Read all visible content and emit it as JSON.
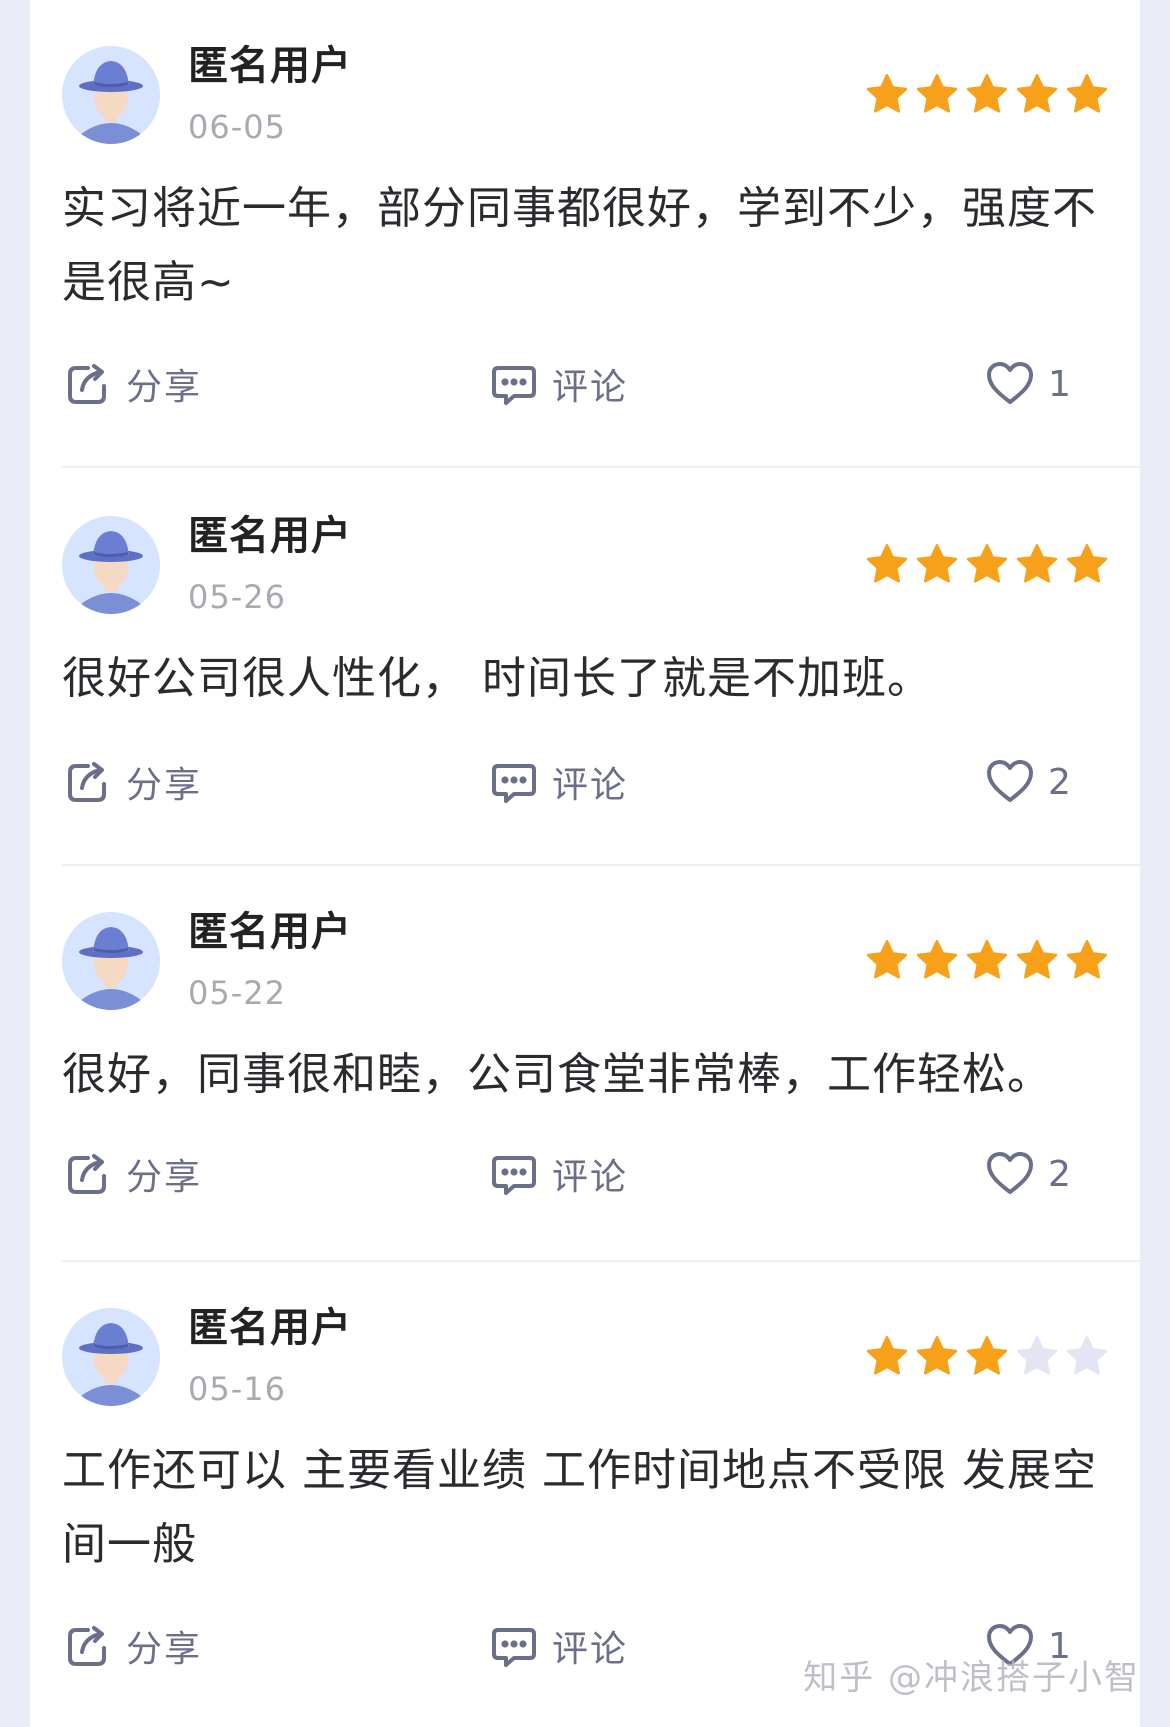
{
  "reviews": [
    {
      "username": "匿名用户",
      "date": "06-05",
      "rating": 5,
      "content": "实习将近一年，部分同事都很好，学到不少，强度不是很高~",
      "share_label": "分享",
      "comment_label": "评论",
      "likes": "1"
    },
    {
      "username": "匿名用户",
      "date": "05-26",
      "rating": 5,
      "content": "很好公司很人性化， 时间长了就是不加班。",
      "share_label": "分享",
      "comment_label": "评论",
      "likes": "2"
    },
    {
      "username": "匿名用户",
      "date": "05-22",
      "rating": 5,
      "content": "很好，同事很和睦，公司食堂非常棒，工作轻松。",
      "share_label": "分享",
      "comment_label": "评论",
      "likes": "2"
    },
    {
      "username": "匿名用户",
      "date": "05-16",
      "rating": 3,
      "content": "工作还可以 主要看业绩 工作时间地点不受限 发展空间一般",
      "share_label": "分享",
      "comment_label": "评论",
      "likes": "1"
    }
  ],
  "max_rating": 5,
  "colors": {
    "star_filled": "#f7a11a",
    "star_empty": "#e3e6f2",
    "icon": "#6b6f8a"
  },
  "icons": {
    "share": "share-icon",
    "comment": "comment-icon",
    "like": "heart-icon",
    "star": "star-icon",
    "avatar": "anonymous-avatar"
  },
  "watermark": "知乎 @冲浪搭子小智"
}
